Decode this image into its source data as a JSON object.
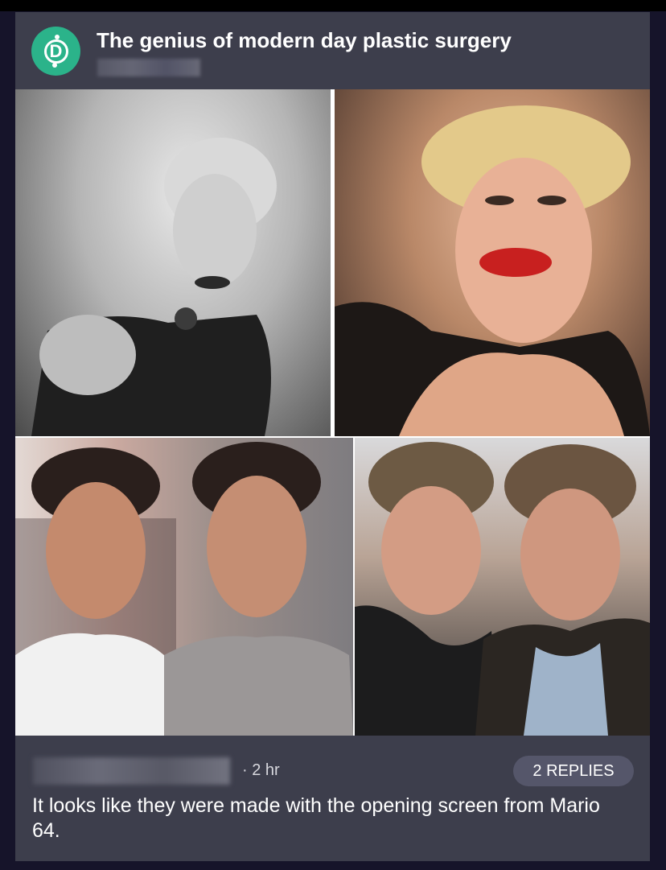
{
  "post": {
    "title": "The genius of modern day plastic surgery",
    "avatar_letter": "D"
  },
  "images": [
    {
      "icon": "photo-woman-before"
    },
    {
      "icon": "photo-woman-after"
    },
    {
      "icon": "photo-twins-before"
    },
    {
      "icon": "photo-twins-after"
    }
  ],
  "comment": {
    "time": "· 2 hr",
    "replies_label": "2 REPLIES",
    "text": "It looks like they were made with the opening screen from Mario 64."
  },
  "colors": {
    "background": "#16142a",
    "card": "#3d3e4c",
    "avatar": "#2bb38a",
    "replies_pill": "#55566a"
  }
}
